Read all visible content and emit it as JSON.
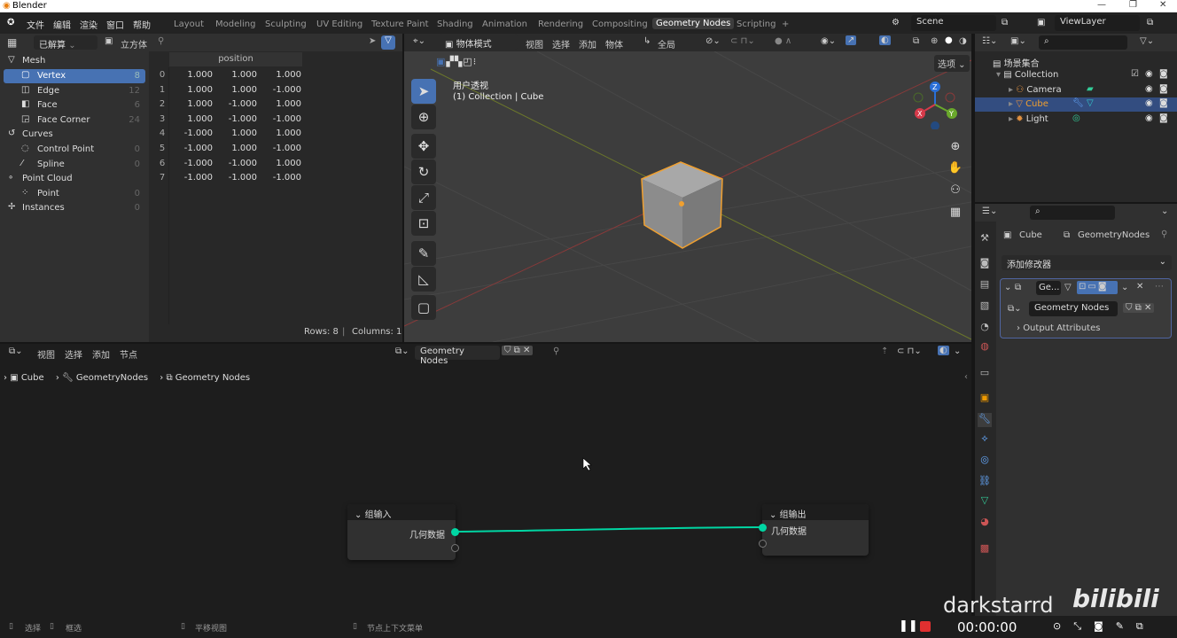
{
  "window": {
    "title": "Blender",
    "controls": [
      "—",
      "❐",
      "✕"
    ]
  },
  "menubar": {
    "menus": [
      "文件",
      "编辑",
      "渲染",
      "窗口",
      "帮助"
    ],
    "workspaces": [
      "Layout",
      "Modeling",
      "Sculpting",
      "UV Editing",
      "Texture Paint",
      "Shading",
      "Animation",
      "Rendering",
      "Compositing",
      "Geometry Nodes",
      "Scripting"
    ],
    "active_workspace": "Geometry Nodes",
    "add_tab": "+",
    "scene": "Scene",
    "view_layer": "ViewLayer"
  },
  "spreadsheet": {
    "mode": "已解算",
    "object": "立方体",
    "domains": [
      {
        "label": "Mesh",
        "count": "",
        "level": "top"
      },
      {
        "label": "Vertex",
        "count": "8",
        "level": "sub",
        "selected": true
      },
      {
        "label": "Edge",
        "count": "12",
        "level": "sub"
      },
      {
        "label": "Face",
        "count": "6",
        "level": "sub"
      },
      {
        "label": "Face Corner",
        "count": "24",
        "level": "sub"
      },
      {
        "label": "Curves",
        "count": "",
        "level": "top"
      },
      {
        "label": "Control Point",
        "count": "0",
        "level": "sub"
      },
      {
        "label": "Spline",
        "count": "0",
        "level": "sub"
      },
      {
        "label": "Point Cloud",
        "count": "",
        "level": "top"
      },
      {
        "label": "Point",
        "count": "0",
        "level": "sub"
      },
      {
        "label": "Instances",
        "count": "0",
        "level": "top"
      }
    ],
    "column": "position",
    "rows": [
      [
        "0",
        "1.000",
        "1.000",
        "1.000"
      ],
      [
        "1",
        "1.000",
        "1.000",
        "-1.000"
      ],
      [
        "2",
        "1.000",
        "-1.000",
        "1.000"
      ],
      [
        "3",
        "1.000",
        "-1.000",
        "-1.000"
      ],
      [
        "4",
        "-1.000",
        "1.000",
        "1.000"
      ],
      [
        "5",
        "-1.000",
        "1.000",
        "-1.000"
      ],
      [
        "6",
        "-1.000",
        "-1.000",
        "1.000"
      ],
      [
        "7",
        "-1.000",
        "-1.000",
        "-1.000"
      ]
    ],
    "footer_rows": "Rows: 8",
    "footer_sep": "|",
    "footer_cols": "Columns: 1"
  },
  "viewport": {
    "mode": "物体模式",
    "menus": [
      "视图",
      "选择",
      "添加",
      "物体"
    ],
    "transform": "全局",
    "options": "选项",
    "view_name": "用户透视",
    "collection_info": "(1) Collection | Cube",
    "gizmo": {
      "x": "X",
      "y": "Y",
      "z": "Z"
    },
    "accent": "#4772b3",
    "select_color": "#f0a030"
  },
  "outliner": {
    "root": "场景集合",
    "items": [
      {
        "label": "Collection",
        "level": 0
      },
      {
        "label": "Camera",
        "level": 1
      },
      {
        "label": "Cube",
        "level": 1,
        "selected": true
      },
      {
        "label": "Light",
        "level": 1
      }
    ]
  },
  "properties": {
    "object": "Cube",
    "modifier_name": "GeometryNodes",
    "add_modifier": "添加修改器",
    "modifier_short": "Ge...",
    "node_group": "Geometry Nodes",
    "output_attrs": "Output Attributes"
  },
  "node_editor": {
    "menus": [
      "视图",
      "选择",
      "添加",
      "节点"
    ],
    "node_group": "Geometry Nodes",
    "breadcrumb": [
      "Cube",
      "GeometryNodes",
      "Geometry Nodes"
    ],
    "group_input": {
      "title": "组输入",
      "socket": "几何数据"
    },
    "group_output": {
      "title": "组输出",
      "socket": "几何数据"
    },
    "link_color": "#00d6a3"
  },
  "statusbar": {
    "hints": [
      "选择",
      "框选",
      "平移视图",
      "节点上下文菜单"
    ],
    "timer": "00:00:00",
    "watermark": "darkstarrd",
    "logo": "bilibili"
  }
}
